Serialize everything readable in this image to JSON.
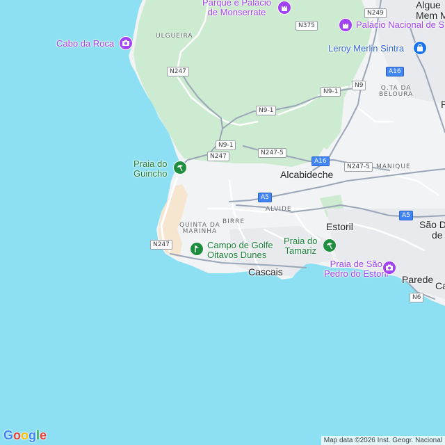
{
  "map": {
    "colors": {
      "water": "#8ddff3",
      "land": "#f1f3f4",
      "park": "#cdebd0",
      "beach": "#f6e5cf",
      "urban": "#e8eaed",
      "road": "#ffffff",
      "major_road": "#9aa5b8"
    },
    "places": {
      "ulgueira": "ULGUEIRA",
      "quinta_da_marinha_1": "QUINTA DA",
      "quinta_da_marinha_2": "MARINHA",
      "birre": "BIRRE",
      "alvide": "ALVIDE",
      "manique": "MANIQUE",
      "qta_beloura_1": "Q.TA DA",
      "qta_beloura_2": "BELOURA",
      "alcabideche": "Alcabideche",
      "estoril": "Estoril",
      "cascais": "Cascais",
      "parede": "Parede",
      "sao_do_1": "São Do",
      "sao_do_2": "de",
      "algueirao_1": "Algue",
      "algueirao_2": "Mem M",
      "edge_p": "P",
      "edge_ca": "Ca"
    },
    "pois": {
      "cabo_da_roca": "Cabo da Roca",
      "monserrate_1": "Parque e Palácio",
      "monserrate_2": "de Monserrate",
      "palacio_sintra": "Palácio Nacional de S",
      "leroy_merlin": "Leroy Merlin Sintra",
      "guincho_1": "Praia do",
      "guincho_2": "Guincho",
      "golfe_1": "Campo de Golfe",
      "golfe_2": "Oitavos Dunes",
      "tamariz_1": "Praia do",
      "tamariz_2": "Tamariz",
      "sao_pedro_1": "Praia de São",
      "sao_pedro_2": "Pedro do Estoril"
    },
    "shields": {
      "n249": "N249",
      "n375": "N375",
      "n247_a": "N247",
      "a16_a": "A16",
      "n9": "N9",
      "n9_1_a": "N9-1",
      "n9_1_b": "N9-1",
      "n9_1_c": "N9-1",
      "n247_b": "N247",
      "n247_5_a": "N247-5",
      "a16_b": "A16",
      "n247_5_b": "N247-5",
      "a5_a": "A5",
      "a5_b": "A5",
      "n247_c": "N247",
      "n6": "N6"
    }
  },
  "logo": {
    "letters": [
      "G",
      "o",
      "o",
      "g",
      "l",
      "e"
    ],
    "colors": [
      "#4285f4",
      "#ea4335",
      "#fbbc05",
      "#4285f4",
      "#34a853",
      "#ea4335"
    ]
  },
  "attribution": "Map data ©2026 Inst. Geogr. Nacional"
}
